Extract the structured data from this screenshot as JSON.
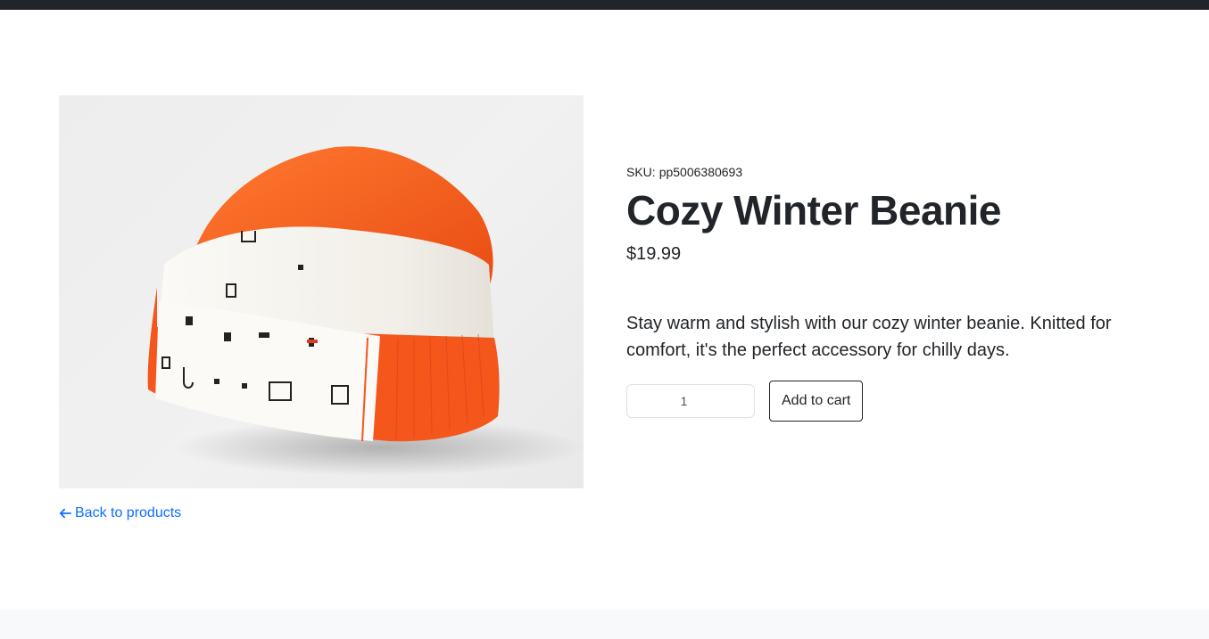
{
  "product": {
    "sku_label": "SKU:",
    "sku": "pp5006380693",
    "title": "Cozy Winter Beanie",
    "price": "$19.99",
    "description": "Stay warm and stylish with our cozy winter beanie. Knitted for comfort, it's the perfect accessory for chilly days.",
    "image_alt": "Cozy Winter Beanie"
  },
  "purchase": {
    "quantity": "1",
    "add_to_cart_label": "Add to cart"
  },
  "navigation": {
    "back_label": "Back to products",
    "back_icon": "arrow-left-icon"
  },
  "colors": {
    "link": "#0d6efd",
    "text": "#212529",
    "beanie_orange": "#f4561c"
  }
}
